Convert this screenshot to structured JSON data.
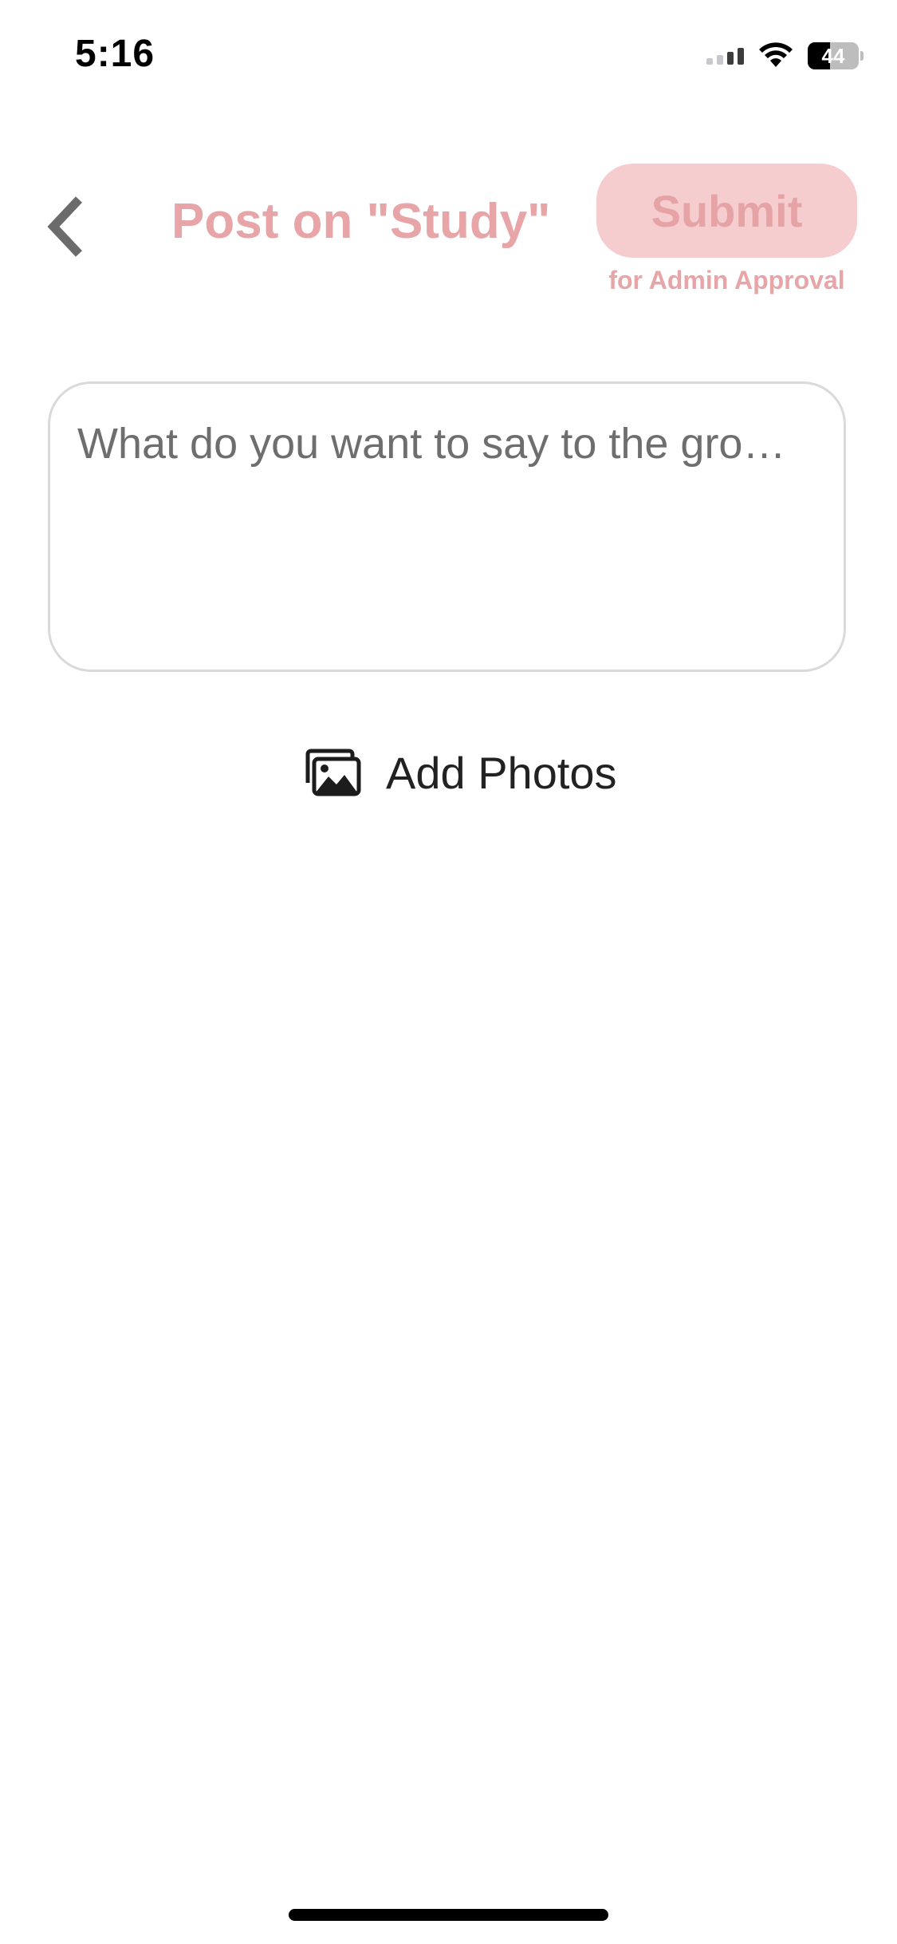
{
  "status_bar": {
    "time": "5:16",
    "battery_level": "44",
    "battery_fraction": 0.44,
    "signal_bars_active": 2,
    "signal_bars_total": 4
  },
  "header": {
    "back_icon": "chevron-left-icon",
    "title": "Post on \"Study\"",
    "submit_label": "Submit",
    "submit_note": "for Admin Approval"
  },
  "composer": {
    "placeholder": "What do you want to say to the gro…",
    "value": ""
  },
  "add_photos": {
    "icon": "photo-stack-icon",
    "label": "Add Photos"
  },
  "colors": {
    "accent": "#e8a5a8",
    "submit_background": "#f6cdcf",
    "border": "#dadada",
    "placeholder": "#6e6e6e",
    "back_icon": "#6b6b6b"
  }
}
